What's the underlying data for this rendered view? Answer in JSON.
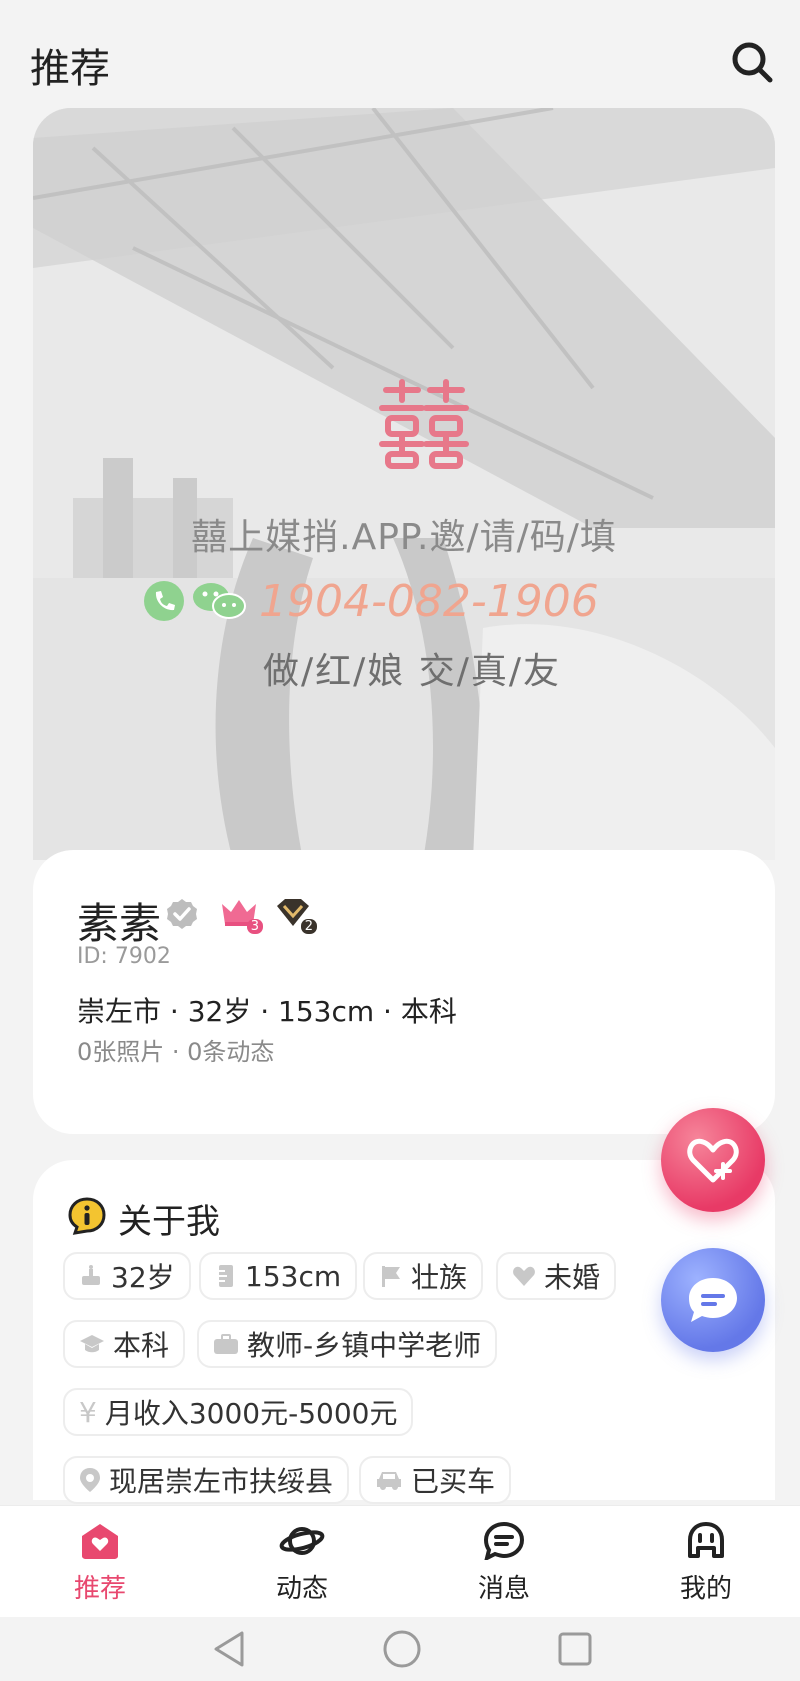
{
  "header": {
    "title": "推荐"
  },
  "watermark": {
    "line1": "囍上媒捎.APP.邀/请/码/填",
    "phone": "1904-082-1906",
    "line3": "做/红/娘 交/真/友"
  },
  "profile": {
    "name": "素素",
    "crown_level": "3",
    "diamond_level": "2",
    "id_label": "ID: 7902",
    "info_line": "崇左市 · 32岁 · 153cm · 本科",
    "sub_line": "0张照片 · 0条动态"
  },
  "about": {
    "title": "关于我",
    "tags": [
      {
        "icon": "cake-icon",
        "label": "32岁"
      },
      {
        "icon": "height-icon",
        "label": "153cm"
      },
      {
        "icon": "flag-icon",
        "label": "壮族"
      },
      {
        "icon": "heart-icon",
        "label": "未婚"
      },
      {
        "icon": "graduation-cap-icon",
        "label": "本科"
      },
      {
        "icon": "briefcase-icon",
        "label": "教师-乡镇中学老师"
      },
      {
        "icon": "yen-icon",
        "label": "月收入3000元-5000元"
      },
      {
        "icon": "location-pin-icon",
        "label": "现居崇左市扶绥县"
      },
      {
        "icon": "car-icon",
        "label": "已买车"
      }
    ]
  },
  "bottom_nav": {
    "items": [
      {
        "label": "推荐",
        "icon": "home-heart-icon",
        "active": true
      },
      {
        "label": "动态",
        "icon": "planet-icon",
        "active": false
      },
      {
        "label": "消息",
        "icon": "message-icon",
        "active": false
      },
      {
        "label": "我的",
        "icon": "profile-icon",
        "active": false
      }
    ]
  },
  "colors": {
    "accent": "#e8486f",
    "like_button": "#e83a66",
    "chat_button": "#6478e8"
  }
}
